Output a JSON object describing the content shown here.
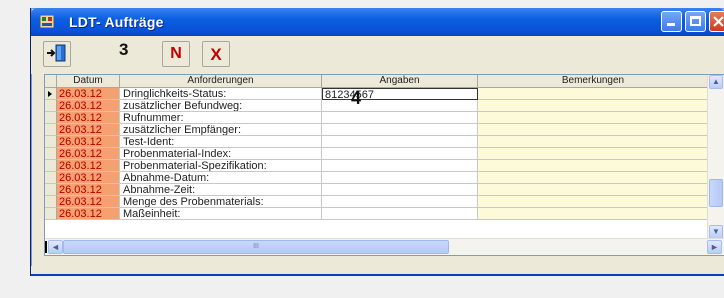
{
  "window": {
    "title": "LDT- Aufträge",
    "icon": "app-table-icon",
    "controls": [
      "minimize-icon",
      "maximize-icon",
      "close-icon"
    ]
  },
  "toolbar": {
    "buttons": [
      {
        "icon": "exit-door-icon",
        "label": ""
      },
      {
        "icon": "new-icon",
        "label": "N"
      },
      {
        "icon": "delete-icon",
        "label": "X"
      }
    ]
  },
  "annotations": {
    "marker_3": "3",
    "marker_4": "4"
  },
  "table": {
    "columns": [
      "Datum",
      "Anforderungen",
      "Angaben",
      "Bemerkungen"
    ],
    "rows": [
      {
        "date": "26.03.12",
        "req": "Dringlichkeits-Status:",
        "val": "81234567",
        "rem": "",
        "selected": true
      },
      {
        "date": "26.03.12",
        "req": "zusätzlicher Befundweg:",
        "val": "",
        "rem": ""
      },
      {
        "date": "26.03.12",
        "req": "Rufnummer:",
        "val": "",
        "rem": ""
      },
      {
        "date": "26.03.12",
        "req": "zusätzlicher Empfänger:",
        "val": "",
        "rem": ""
      },
      {
        "date": "26.03.12",
        "req": "Test-Ident:",
        "val": "",
        "rem": ""
      },
      {
        "date": "26.03.12",
        "req": "Probenmaterial-Index:",
        "val": "",
        "rem": ""
      },
      {
        "date": "26.03.12",
        "req": "Probenmaterial-Spezifikation:",
        "val": "",
        "rem": ""
      },
      {
        "date": "26.03.12",
        "req": "Abnahme-Datum:",
        "val": "",
        "rem": ""
      },
      {
        "date": "26.03.12",
        "req": "Abnahme-Zeit:",
        "val": "",
        "rem": ""
      },
      {
        "date": "26.03.12",
        "req": "Menge des Probenmaterials:",
        "val": "",
        "rem": ""
      },
      {
        "date": "26.03.12",
        "req": "Maßeinheit:",
        "val": "",
        "rem": ""
      }
    ]
  },
  "scrollbars": {
    "up": "▲",
    "down": "▼",
    "left": "◄",
    "right": "►",
    "grip": "III"
  },
  "colors": {
    "date_cell": "#f4a070",
    "date_text": "#b00000",
    "remarks_cell": "#fcfad8",
    "title_bar": "#0b5ee0"
  }
}
